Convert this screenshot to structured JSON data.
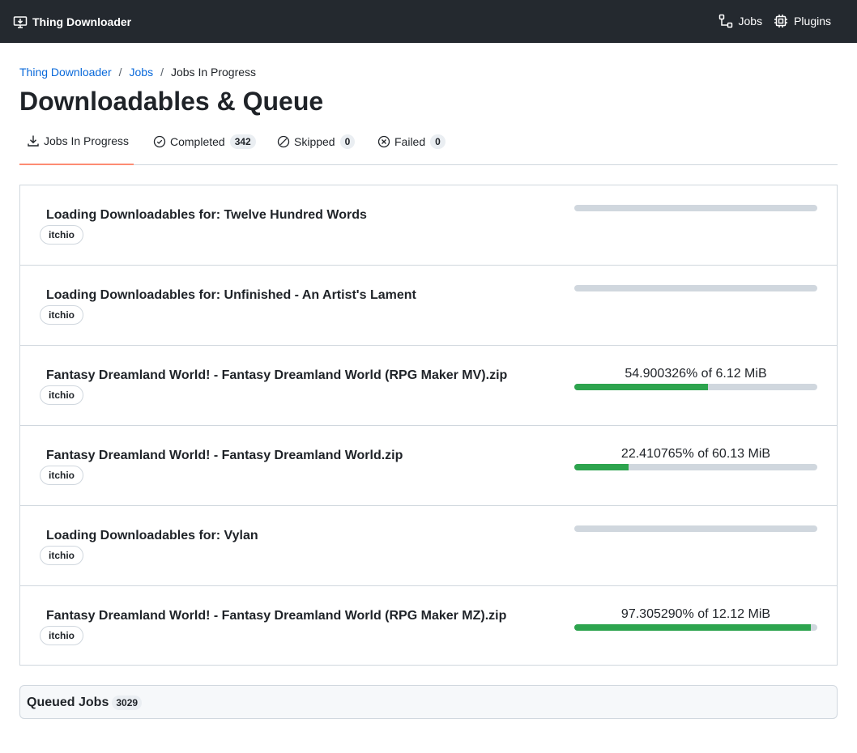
{
  "app": {
    "title": "Thing Downloader",
    "icon": "download-box-icon"
  },
  "nav": {
    "items": [
      {
        "label": "Jobs",
        "icon": "workflow-icon"
      },
      {
        "label": "Plugins",
        "icon": "cpu-icon"
      }
    ]
  },
  "breadcrumb": {
    "items": [
      "Thing Downloader",
      "Jobs"
    ],
    "separator": "/",
    "current": "Jobs In Progress"
  },
  "page": {
    "title": "Downloadables & Queue"
  },
  "tabs": [
    {
      "label": "Jobs In Progress",
      "icon": "download-icon",
      "count": null,
      "active": true
    },
    {
      "label": "Completed",
      "icon": "check-circle-icon",
      "count": "342",
      "active": false
    },
    {
      "label": "Skipped",
      "icon": "skip-icon",
      "count": "0",
      "active": false
    },
    {
      "label": "Failed",
      "icon": "x-circle-icon",
      "count": "0",
      "active": false
    }
  ],
  "jobs": [
    {
      "title": "Loading Downloadables for: Twelve Hundred Words",
      "source": "itchio",
      "progress_text": "",
      "progress": 0
    },
    {
      "title": "Loading Downloadables for: Unfinished - An Artist's Lament",
      "source": "itchio",
      "progress_text": "",
      "progress": 0
    },
    {
      "title": "Fantasy Dreamland World! - Fantasy Dreamland World (RPG Maker MV).zip",
      "source": "itchio",
      "progress_text": "54.900326% of 6.12 MiB",
      "progress": 54.900326
    },
    {
      "title": "Fantasy Dreamland World! - Fantasy Dreamland World.zip",
      "source": "itchio",
      "progress_text": "22.410765% of 60.13 MiB",
      "progress": 22.410765
    },
    {
      "title": "Loading Downloadables for: Vylan",
      "source": "itchio",
      "progress_text": "",
      "progress": 0
    },
    {
      "title": "Fantasy Dreamland World! - Fantasy Dreamland World (RPG Maker MZ).zip",
      "source": "itchio",
      "progress_text": "97.305290% of 12.12 MiB",
      "progress": 97.30529
    }
  ],
  "queued": {
    "title": "Queued Jobs",
    "count": "3029"
  },
  "colors": {
    "topbar": "#24292f",
    "link": "#0969da",
    "progress_fill": "#2da44e",
    "progress_track": "#d0d7de",
    "active_tab_underline": "#fd8c73"
  }
}
